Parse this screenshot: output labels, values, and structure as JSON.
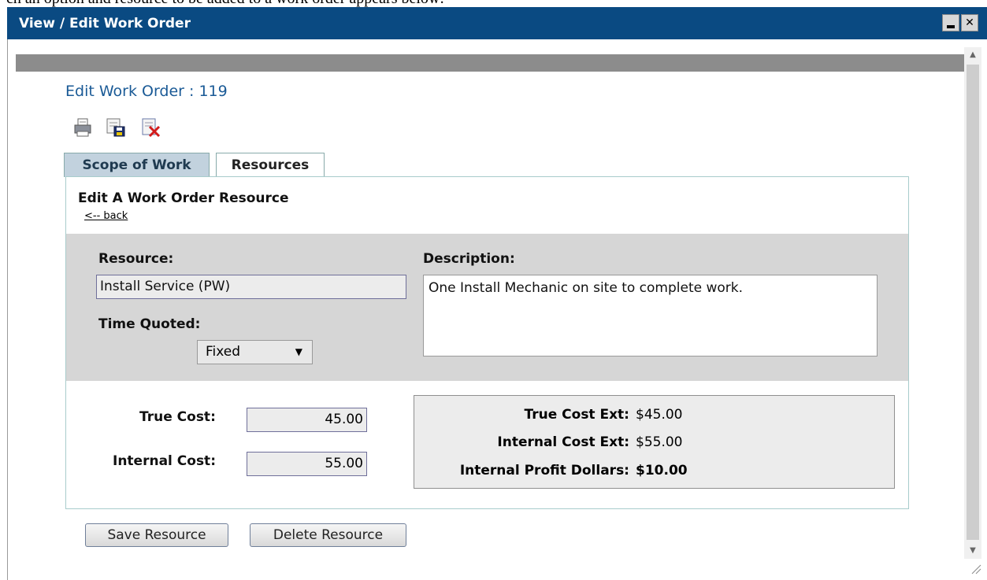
{
  "window": {
    "title": "View / Edit Work Order",
    "caption_above": "ch an option and resource to be added to a work order appears below:"
  },
  "page": {
    "title": "Edit Work Order : 119"
  },
  "toolbar": {
    "icons": [
      "print-icon",
      "save-icon",
      "cancel-icon"
    ]
  },
  "tabs": [
    {
      "label": "Scope of Work",
      "active": false
    },
    {
      "label": "Resources",
      "active": true
    }
  ],
  "form": {
    "section_title": "Edit A Work Order Resource",
    "back_link": "<-- back",
    "resource_label": "Resource:",
    "resource_value": "Install Service (PW)",
    "description_label": "Description:",
    "description_value": "One Install Mechanic on site to complete work.",
    "time_quoted_label": "Time Quoted:",
    "time_quoted_value": "Fixed",
    "true_cost_label": "True Cost:",
    "true_cost_value": "45.00",
    "internal_cost_label": "Internal Cost:",
    "internal_cost_value": "55.00"
  },
  "summary": {
    "true_cost_ext_label": "True Cost Ext:",
    "true_cost_ext_value": "$45.00",
    "internal_cost_ext_label": "Internal Cost Ext:",
    "internal_cost_ext_value": "$55.00",
    "profit_label": "Internal Profit Dollars:",
    "profit_value": "$10.00"
  },
  "buttons": {
    "save": "Save Resource",
    "delete": "Delete Resource"
  },
  "colors": {
    "titlebar": "#0a4a82",
    "page_title": "#1a5a96",
    "panel_gray": "#d6d6d6"
  }
}
